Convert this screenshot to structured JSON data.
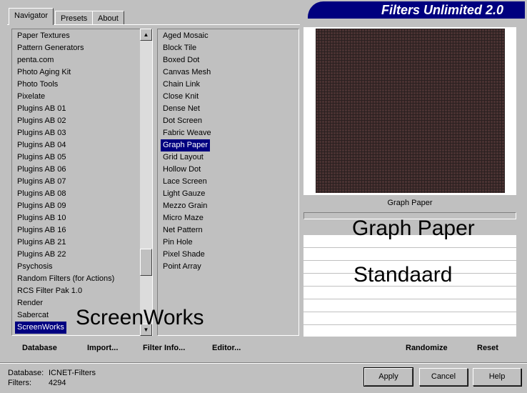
{
  "tabs": [
    "Navigator",
    "Presets",
    "About"
  ],
  "app_title": "Filters Unlimited 2.0",
  "categories": [
    "Paper Textures",
    "Pattern Generators",
    "penta.com",
    "Photo Aging Kit",
    "Photo Tools",
    "Pixelate",
    "Plugins AB 01",
    "Plugins AB 02",
    "Plugins AB 03",
    "Plugins AB 04",
    "Plugins AB 05",
    "Plugins AB 06",
    "Plugins AB 07",
    "Plugins AB 08",
    "Plugins AB 09",
    "Plugins AB 10",
    "Plugins AB 16",
    "Plugins AB 21",
    "Plugins AB 22",
    "Psychosis",
    "Random Filters (for Actions)",
    "RCS Filter Pak 1.0",
    "Render",
    "Sabercat",
    "ScreenWorks"
  ],
  "selected_category": "ScreenWorks",
  "filters": [
    "Aged Mosaic",
    "Block Tile",
    "Boxed Dot",
    "Canvas Mesh",
    "Chain Link",
    "Close Knit",
    "Dense Net",
    "Dot Screen",
    "Fabric Weave",
    "Graph Paper",
    "Grid Layout",
    "Hollow Dot",
    "Lace Screen",
    "Light Gauze",
    "Mezzo Grain",
    "Micro Maze",
    "Net Pattern",
    "Pin Hole",
    "Pixel Shade",
    "Point Array"
  ],
  "selected_filter": "Graph Paper",
  "preview_caption": "Graph Paper",
  "overlay": {
    "category": "ScreenWorks",
    "filter": "Graph Paper",
    "preset": "Standaard"
  },
  "actions": {
    "database": "Database",
    "import": "Import...",
    "filter_info": "Filter Info...",
    "editor": "Editor...",
    "randomize": "Randomize",
    "reset": "Reset"
  },
  "status": {
    "database_label": "Database:",
    "database_value": "ICNET-Filters",
    "filters_label": "Filters:",
    "filters_value": "4294"
  },
  "buttons": {
    "apply": "Apply",
    "cancel": "Cancel",
    "help": "Help"
  },
  "colors": {
    "selection": "#000080",
    "banner": "#00007f",
    "preview": "#4a3232"
  }
}
